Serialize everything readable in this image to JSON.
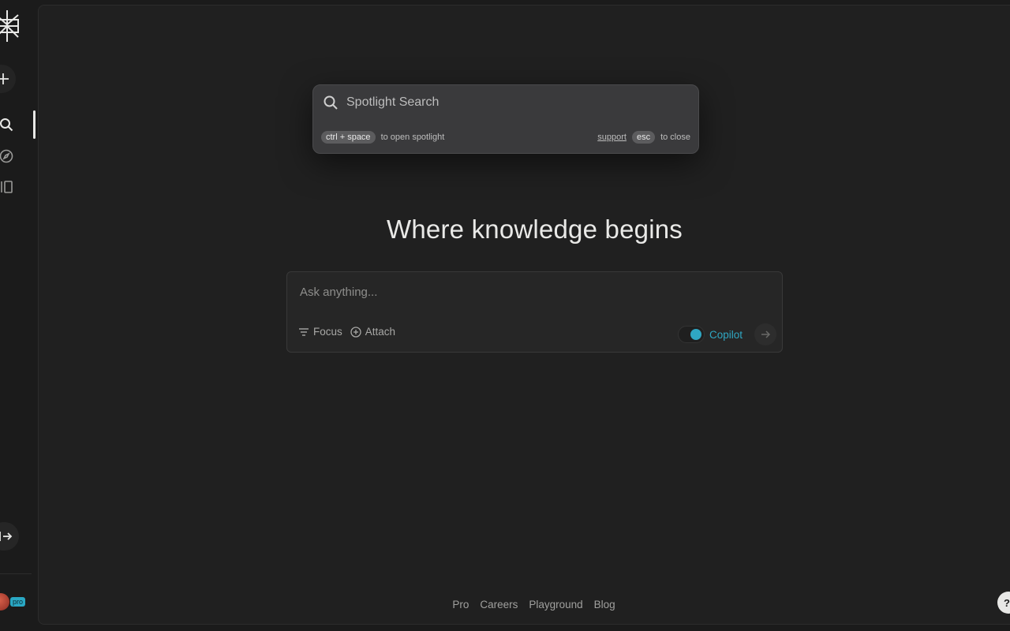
{
  "sidebar": {
    "pro_badge": "pro"
  },
  "spotlight": {
    "placeholder": "Spotlight Search",
    "shortcut_key": "ctrl + space",
    "shortcut_hint": "to open spotlight",
    "support_label": "support",
    "close_key": "esc",
    "close_hint": "to close"
  },
  "main": {
    "headline": "Where knowledge begins"
  },
  "ask": {
    "placeholder": "Ask anything...",
    "focus_label": "Focus",
    "attach_label": "Attach",
    "copilot_label": "Copilot",
    "copilot_on": true
  },
  "footer": {
    "links": [
      "Pro",
      "Careers",
      "Playground",
      "Blog"
    ]
  },
  "help": {
    "label": "?"
  },
  "colors": {
    "background": "#202020",
    "sidebar": "#1b1b1b",
    "accent": "#2fa7c3",
    "spotlight_bg": "#3a3a3c"
  }
}
